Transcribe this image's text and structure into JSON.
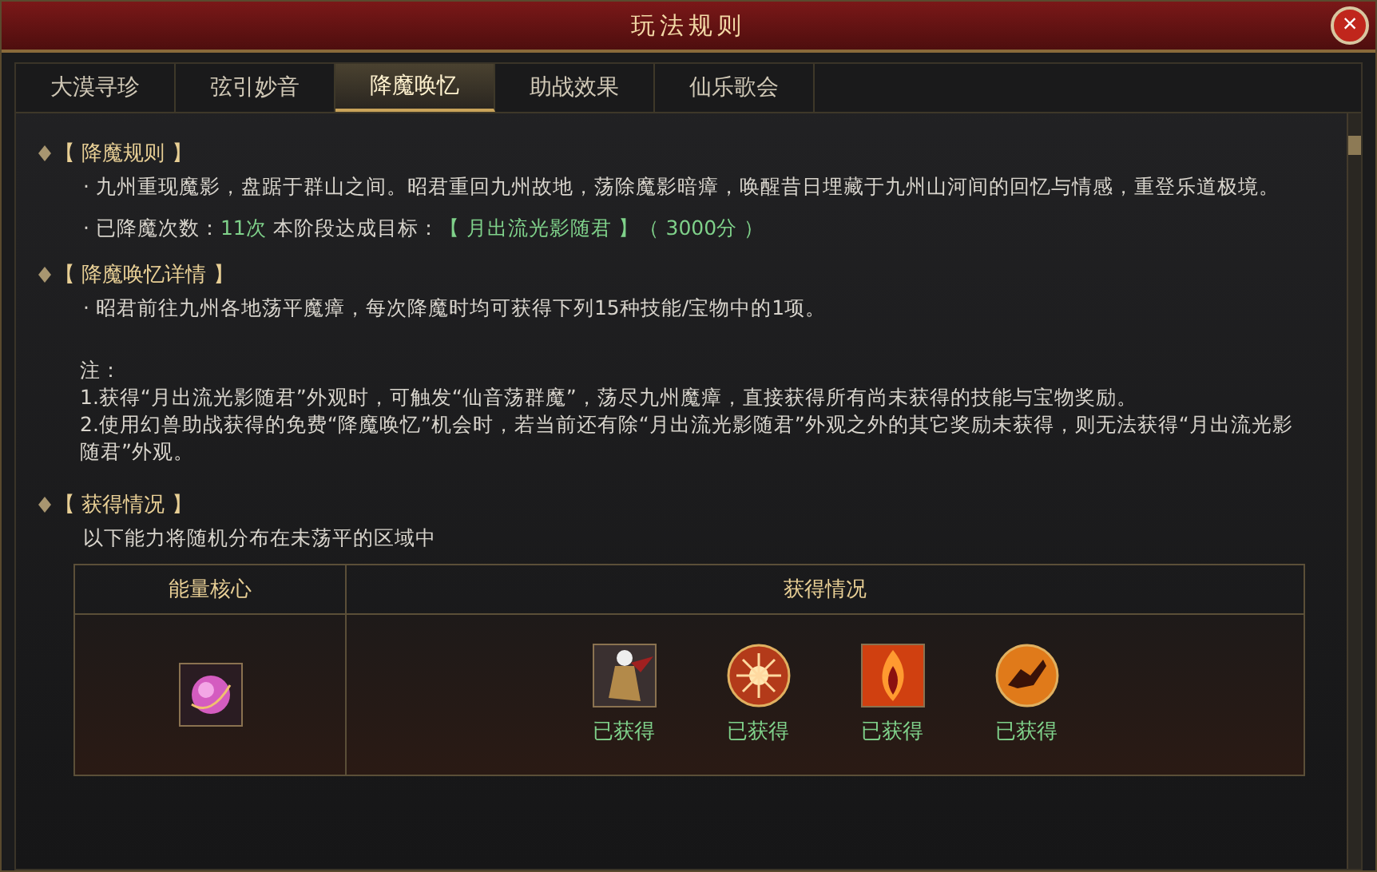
{
  "window": {
    "title": "玩法规则",
    "close": "×"
  },
  "tabs": [
    {
      "label": "大漠寻珍",
      "selected": false
    },
    {
      "label": "弦引妙音",
      "selected": false
    },
    {
      "label": "降魔唤忆",
      "selected": true
    },
    {
      "label": "助战效果",
      "selected": false
    },
    {
      "label": "仙乐歌会",
      "selected": false
    }
  ],
  "sections": [
    {
      "heading": "【 降魔规则 】",
      "paragraphs": [
        {
          "segments": [
            {
              "text": "· 九州重现魔影，盘踞于群山之间。昭君重回九州故地，荡除魔影暗瘴，唤醒昔日埋藏于九州山河间的回忆与情感，重登乐道极境。",
              "highlight": false
            }
          ]
        },
        {
          "segments": [
            {
              "text": "· 已降魔次数：",
              "highlight": false
            },
            {
              "text": "11次",
              "highlight": true
            },
            {
              "text": " 本阶段达成目标：",
              "highlight": false
            },
            {
              "text": "【 月出流光影随君 】（ 3000分 ）",
              "highlight": true
            }
          ]
        }
      ]
    },
    {
      "heading": "【 降魔唤忆详情 】",
      "paragraphs": [
        {
          "segments": [
            {
              "text": "· 昭君前往九州各地荡平魔瘴，每次降魔时均可获得下列15种技能/宝物中的1项。",
              "highlight": false
            }
          ]
        }
      ],
      "notes": [
        "注：",
        "1.获得“月出流光影随君”外观时，可触发“仙音荡群魔”，荡尽九州魔瘴，直接获得所有尚未获得的技能与宝物奖励。",
        "2.使用幻兽助战获得的免费“降魔唤忆”机会时，若当前还有除“月出流光影随君”外观之外的其它奖励未获得，则无法获得“月出流光影随君”外观。"
      ]
    },
    {
      "heading": "【 获得情况 】",
      "paragraphs": [
        {
          "segments": [
            {
              "text": "以下能力将随机分布在未荡平的区域中",
              "highlight": false
            }
          ]
        }
      ],
      "table": {
        "columns": [
          "能量核心",
          "获得情况"
        ],
        "core": {
          "kind": "orb"
        },
        "rewards": [
          {
            "kind": "figure",
            "status": "已获得",
            "obtained": true
          },
          {
            "kind": "burst",
            "status": "已获得",
            "obtained": true
          },
          {
            "kind": "flame",
            "status": "已获得",
            "obtained": true
          },
          {
            "kind": "silhouette",
            "status": "已获得",
            "obtained": true
          }
        ]
      }
    }
  ]
}
